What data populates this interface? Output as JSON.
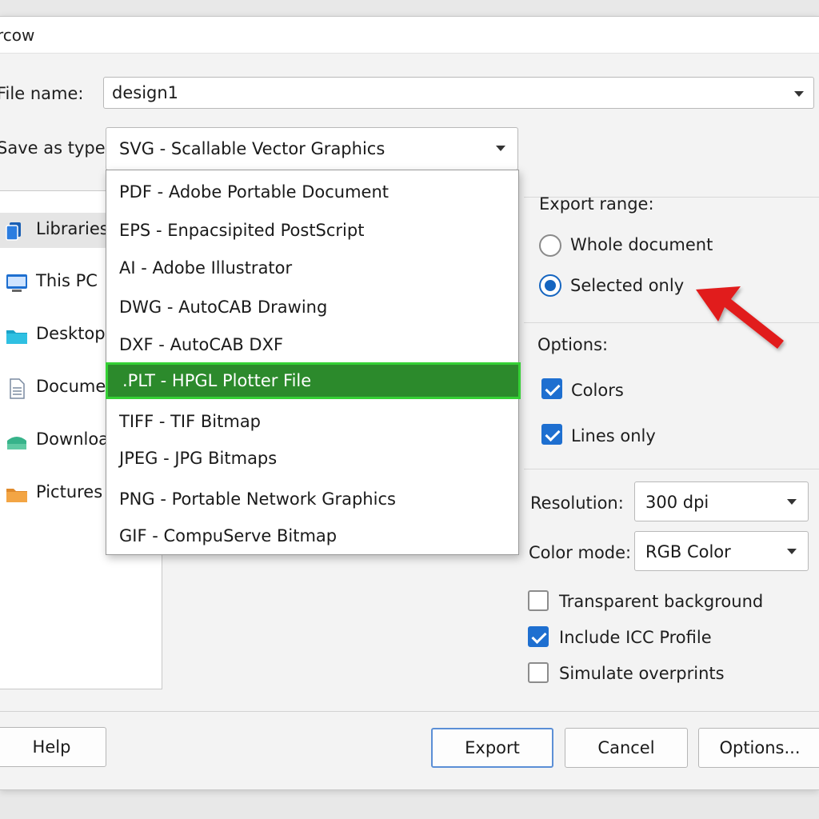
{
  "window": {
    "title": "rcow"
  },
  "file_name": {
    "label": "File name:",
    "value": "design1"
  },
  "save_as_type": {
    "label": "Save as type:",
    "value": "SVG  -  Scallable Vector Graphics"
  },
  "sidebar": {
    "items": [
      {
        "label": "Libraries",
        "icon": "libraries-icon"
      },
      {
        "label": "This PC",
        "icon": "computer-icon"
      },
      {
        "label": "Desktop",
        "icon": "folder-icon"
      },
      {
        "label": "Documents",
        "icon": "document-icon"
      },
      {
        "label": "Downloads",
        "icon": "download-icon"
      },
      {
        "label": "Pictures",
        "icon": "folder-icon"
      }
    ]
  },
  "dropdown": {
    "options": [
      "PDF  -  Adobe Portable Document",
      "EPS  -  Enpacsipited PostScript",
      "AI  -  Adobe Illustrator",
      "DWG  -  AutoCAB Drawing",
      "DXF  -  AutoCAB DXF",
      ".PLT  -  HPGL Plotter File",
      "TIFF  -  TIF Bitmap",
      "JPEG  -  JPG Bitmaps",
      "PNG  -  Portable Network Graphics",
      "GIF  -  CompuServe Bitmap"
    ],
    "highlighted_index": 5,
    "highlight_color": "#2c8a2c"
  },
  "export_range": {
    "heading": "Export range:",
    "whole": "Whole document",
    "selected": "Selected only",
    "selected_value": "Selected only"
  },
  "options": {
    "heading": "Options:",
    "colors": "Colors",
    "lines_only": "Lines only"
  },
  "resolution": {
    "label": "Resolution:",
    "value": "300 dpi"
  },
  "color_mode": {
    "label": "Color mode:",
    "value": "RGB Color"
  },
  "extra": {
    "transparent": "Transparent background",
    "icc": "Include ICC Profile",
    "overprints": "Simulate overprints"
  },
  "buttons": {
    "help": "Help",
    "export": "Export",
    "cancel": "Cancel",
    "options": "Options..."
  },
  "accent_color": "#1565c0",
  "annotation_arrow_color": "#e11b1b"
}
